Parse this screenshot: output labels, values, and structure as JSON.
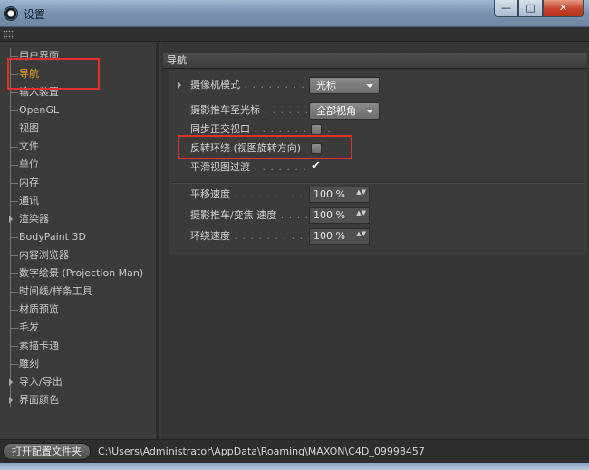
{
  "window": {
    "title": "设置",
    "buttons": {
      "minimize": "—",
      "maximize": "□",
      "close": "✕"
    }
  },
  "sidebar": {
    "items": [
      {
        "label": "用户界面"
      },
      {
        "label": "导航",
        "active": true
      },
      {
        "label": "输入装置"
      },
      {
        "label": "OpenGL"
      },
      {
        "label": "视图"
      },
      {
        "label": "文件"
      },
      {
        "label": "单位"
      },
      {
        "label": "内存"
      },
      {
        "label": "通讯"
      },
      {
        "label": "渲染器",
        "expandable": true
      },
      {
        "label": "BodyPaint 3D"
      },
      {
        "label": "内容浏览器"
      },
      {
        "label": "数字绘景 (Projection Man)"
      },
      {
        "label": "时间线/样条工具"
      },
      {
        "label": "材质预览"
      },
      {
        "label": "毛发"
      },
      {
        "label": "素描卡通"
      },
      {
        "label": "雕刻"
      },
      {
        "label": "导入/导出",
        "expandable": true
      },
      {
        "label": "界面颜色",
        "expandable": true
      }
    ]
  },
  "main": {
    "section_title": "导航",
    "camera_mode": {
      "label": "摄像机模式",
      "value": "光标"
    },
    "dolly_to_cursor": {
      "label": "摄影推车至光标",
      "value": "全部视角"
    },
    "sync_ortho": {
      "label": "同步正交视口",
      "checked": false
    },
    "reverse_orbit": {
      "label": "反转环绕 (视图旋转方向)",
      "checked": false
    },
    "smooth_transition": {
      "label": "平滑视图过渡",
      "checked": true,
      "mark": "✔"
    },
    "pan_speed": {
      "label": "平移速度",
      "value": "100 %"
    },
    "dolly_zoom_speed": {
      "label": "摄影推车/变焦 速度",
      "value": "100 %"
    },
    "orbit_speed": {
      "label": "环绕速度",
      "value": "100 %"
    },
    "spinner_glyph": "▲▼"
  },
  "footer": {
    "open_folder_button": "打开配置文件夹",
    "path": "C:\\Users\\Administrator\\AppData\\Roaming\\MAXON\\C4D_09998457"
  },
  "colors": {
    "accent_active": "#f0a21a",
    "highlight_red": "#e3302b"
  }
}
